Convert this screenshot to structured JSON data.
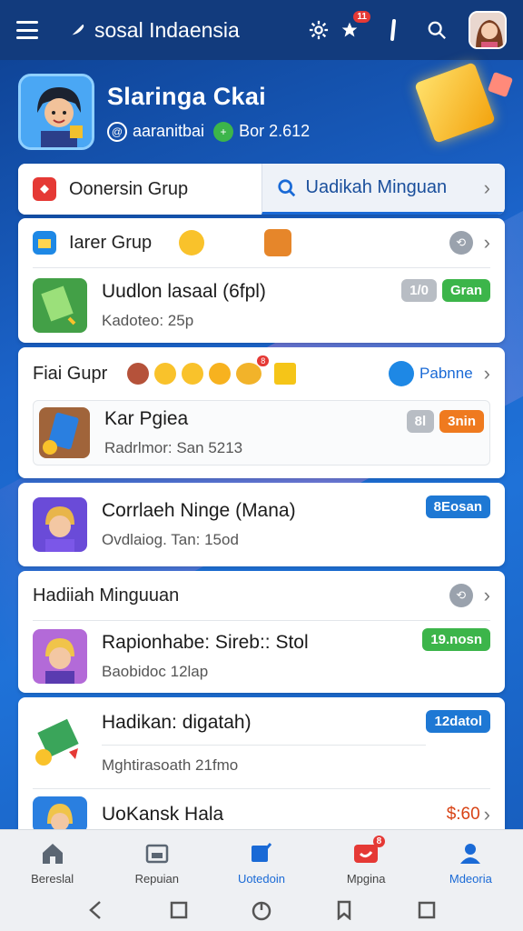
{
  "topbar": {
    "app_title": "sosal Indaensia",
    "notif_count": "11"
  },
  "profile": {
    "name": "Slaringa Ckai",
    "handle": "aaranitbai",
    "points": "Bor 2.612"
  },
  "tabs": [
    {
      "label": "Oonersin Grup",
      "icon": "red-app-icon"
    },
    {
      "label": "Uadikah Minguan",
      "icon": "search-icon"
    }
  ],
  "sections": {
    "group1": {
      "header": "Iarer Grup",
      "item": {
        "title": "Uudlon lasaal (6fpl)",
        "subtitle": "Kadoteo: 25p",
        "count": "1/0",
        "badge": "Gran"
      }
    },
    "group2": {
      "header": "Fiai Gupr",
      "link": "Pabnne",
      "coin_badge": "8",
      "item": {
        "title": "Kar Pgiea",
        "subtitle": "Radrlmor: San 5213",
        "count": "8l",
        "badge": "3nin"
      }
    },
    "group3": {
      "item": {
        "title": "Corrlaeh Ninge (Mana)",
        "subtitle": "Ovdlaiog. Tan: 15od",
        "badge": "8Eosan"
      }
    },
    "group4": {
      "header": "Hadiiah Minguuan",
      "item": {
        "title": "Rapionhabe: Sireb:: Stol",
        "subtitle": "Baobidoc 12lap",
        "badge": "19.nosn"
      }
    },
    "group5": {
      "item1": {
        "title": "Hadikan: digatah)",
        "subtitle": "Mghtirasoath 21fmo",
        "badge": "12datol"
      },
      "item2": {
        "title": "UoKansk Hala",
        "price": "$:60"
      }
    }
  },
  "bottomnav": {
    "items": [
      {
        "label": "Bereslal",
        "icon": "home-icon"
      },
      {
        "label": "Repuian",
        "icon": "store-icon"
      },
      {
        "label": "Uotedoin",
        "icon": "compose-icon"
      },
      {
        "label": "Mpgina",
        "icon": "games-icon"
      },
      {
        "label": "Mdeoria",
        "icon": "profile-icon"
      }
    ],
    "badge": "8"
  },
  "colors": {
    "accent": "#1a6ad6",
    "topbar": "#123b7d",
    "green": "#3cb54a",
    "orange": "#ef7a1f"
  }
}
